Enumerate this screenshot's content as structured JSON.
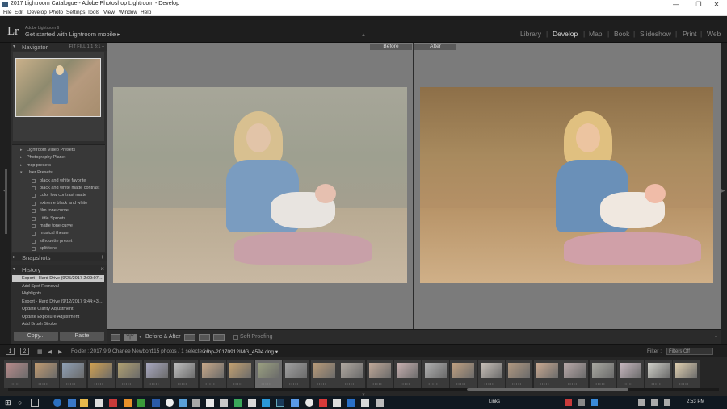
{
  "window": {
    "title": "2017 Lightroom Catalogue - Adobe Photoshop Lightroom - Develop",
    "min_icon": "minimize-icon",
    "max_icon": "maximize-icon",
    "close_icon": "close-icon"
  },
  "menu": [
    "File",
    "Edit",
    "Develop",
    "Photo",
    "Settings",
    "Tools",
    "View",
    "Window",
    "Help"
  ],
  "identity": {
    "logo": "Lr",
    "subtitle": "Adobe Lightroom 6",
    "promo": "Get started with Lightroom mobile ▸"
  },
  "modules": [
    "Library",
    "Develop",
    "Map",
    "Book",
    "Slideshow",
    "Print",
    "Web"
  ],
  "active_module": "Develop",
  "navigator": {
    "title": "Navigator",
    "options": "FIT   FILL   1:1   3:1 ÷"
  },
  "presets": [
    {
      "type": "folder",
      "label": "Lightroom Video Presets",
      "tri": "▸"
    },
    {
      "type": "folder",
      "label": "Photography Planet",
      "tri": "▸"
    },
    {
      "type": "folder",
      "label": "mcp presets",
      "tri": "▸"
    },
    {
      "type": "folder",
      "label": "User Presets",
      "tri": "▾"
    },
    {
      "type": "item",
      "label": "black and white favorite"
    },
    {
      "type": "item",
      "label": "black and white matte contrast"
    },
    {
      "type": "item",
      "label": "color low contrast matte"
    },
    {
      "type": "item",
      "label": "extreme black and white"
    },
    {
      "type": "item",
      "label": "film tone curve"
    },
    {
      "type": "item",
      "label": "Little Sprouts"
    },
    {
      "type": "item",
      "label": "matte tone curve"
    },
    {
      "type": "item",
      "label": "musical theater"
    },
    {
      "type": "item",
      "label": "silhouette preset"
    },
    {
      "type": "item",
      "label": "split tone"
    }
  ],
  "snapshots": {
    "title": "Snapshots",
    "add": "+"
  },
  "history": {
    "title": "History",
    "clear": "×",
    "items": [
      "Export - Hard Drive (9/25/2017 2:09:07 ...",
      "Add Spot Removal",
      "Highlights",
      "Export - Hard Drive (9/12/2017 9:44:43 ...",
      "Update Clarity Adjustment",
      "Update Exposure Adjustment",
      "Add Brush Stroke"
    ],
    "selected_index": 0
  },
  "buttons": {
    "copy": "Copy...",
    "paste": "Paste"
  },
  "compare": {
    "before": "Before",
    "after": "After"
  },
  "toolbar": {
    "view_mode": "Y|Y",
    "before_after": "Before & After :",
    "soft_proofing": "Soft Proofing"
  },
  "filmstrip_header": {
    "page1": "1",
    "page2": "2",
    "folder": "Folder : 2017.9.9 Charlee Newborn",
    "count": "115 photos / 1 selected /",
    "filename": "clhp-20170912IMG_4594.dng ▾",
    "filter_label": "Filter :",
    "filter_value": "Filters Off"
  },
  "thumbnails": [
    {
      "tone": "#b68a8a",
      "selected": false
    },
    {
      "tone": "#c09a70",
      "selected": false
    },
    {
      "tone": "#8fa0b5",
      "selected": false
    },
    {
      "tone": "#d0a050",
      "selected": false
    },
    {
      "tone": "#b0a070",
      "selected": false
    },
    {
      "tone": "#a8a8c0",
      "selected": false
    },
    {
      "tone": "#bfbfbf",
      "selected": false
    },
    {
      "tone": "#c8a888",
      "selected": false
    },
    {
      "tone": "#c2a070",
      "selected": false
    },
    {
      "tone": "#9aa080",
      "selected": true
    },
    {
      "tone": "#a0a0a0",
      "selected": false
    },
    {
      "tone": "#b89a78",
      "selected": false
    },
    {
      "tone": "#b0a8a0",
      "selected": false
    },
    {
      "tone": "#c0a898",
      "selected": false
    },
    {
      "tone": "#c8b0b0",
      "selected": false
    },
    {
      "tone": "#b0b0b0",
      "selected": false
    },
    {
      "tone": "#c0a080",
      "selected": false
    },
    {
      "tone": "#c8c0b8",
      "selected": false
    },
    {
      "tone": "#b09880",
      "selected": false
    },
    {
      "tone": "#c8a890",
      "selected": false
    },
    {
      "tone": "#b8a8a8",
      "selected": false
    },
    {
      "tone": "#a8a8a0",
      "selected": false
    },
    {
      "tone": "#c8b8c0",
      "selected": false
    },
    {
      "tone": "#d0d0c8",
      "selected": false
    },
    {
      "tone": "#e0d0b0",
      "selected": false
    }
  ],
  "taskbar": {
    "tray": "Links",
    "time": "2:53 PM"
  }
}
